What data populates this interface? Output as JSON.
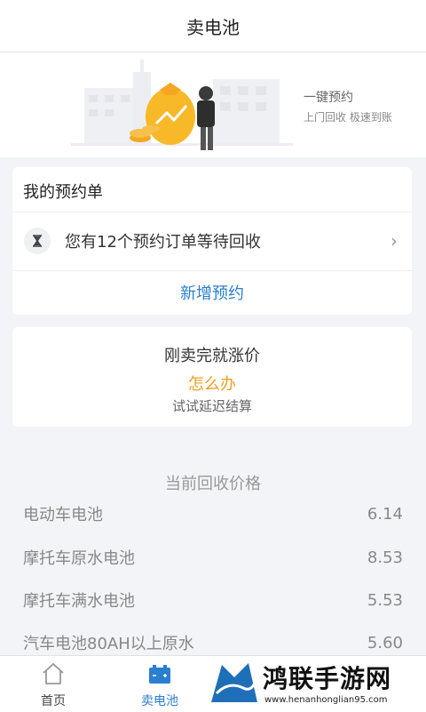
{
  "header": {
    "title": "卖电池"
  },
  "banner": {
    "slogan": "一键预约",
    "subtext": "上门回收 极速到账"
  },
  "orders": {
    "title": "我的预约单",
    "pending_text": "您有12个预约订单等待回收",
    "new_button": "新增预约"
  },
  "promo": {
    "title": "刚卖完就涨价",
    "action": "怎么办",
    "subtitle": "试试延迟结算"
  },
  "prices": {
    "header": "当前回收价格",
    "items": [
      {
        "name": "电动车电池",
        "price": "6.14"
      },
      {
        "name": "摩托车原水电池",
        "price": "8.53"
      },
      {
        "name": "摩托车满水电池",
        "price": "5.53"
      },
      {
        "name": "汽车电池80AH以上原水",
        "price": "5.60"
      }
    ]
  },
  "tabs": [
    {
      "label": "首页",
      "icon": "home-icon",
      "active": false
    },
    {
      "label": "卖电池",
      "icon": "battery-icon",
      "active": true
    }
  ],
  "watermark": {
    "title": "鸿联手游网",
    "url": "www.henanhonglian95.com"
  },
  "colors": {
    "accent": "#2b7fd0",
    "highlight": "#f0a020",
    "background": "#f2f4f7"
  }
}
